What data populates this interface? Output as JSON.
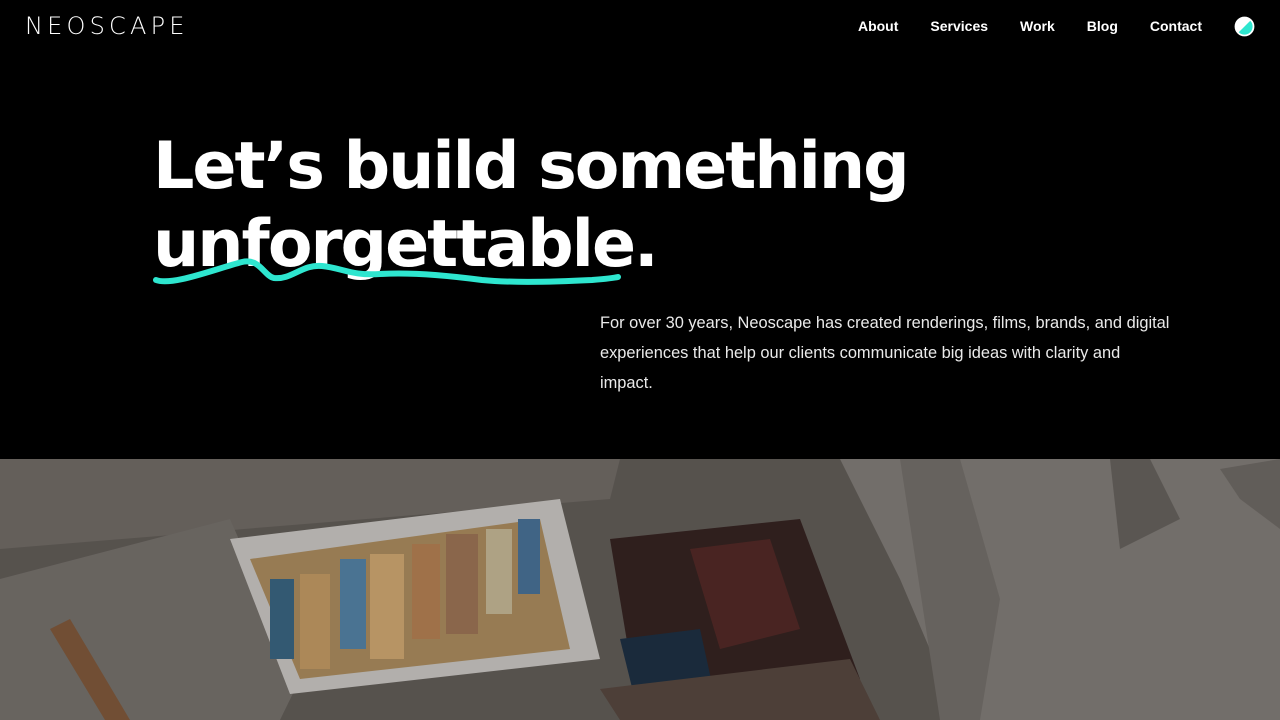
{
  "header": {
    "logo": "NEOSCAPE",
    "nav": [
      {
        "label": "About"
      },
      {
        "label": "Services"
      },
      {
        "label": "Work"
      },
      {
        "label": "Blog"
      },
      {
        "label": "Contact"
      }
    ],
    "theme_toggle_icon": "half-circle-icon"
  },
  "hero": {
    "title_line1": "Let’s build something",
    "title_line2": "unforgettable.",
    "underline_color": "#2ee6cf",
    "intro": "For over 30 years, Neoscape has created renderings, films, brands, and digital experiences that help our clients communicate big ideas with clarity and impact."
  },
  "colors": {
    "background": "#000000",
    "text": "#ffffff",
    "accent": "#2ee6cf"
  }
}
